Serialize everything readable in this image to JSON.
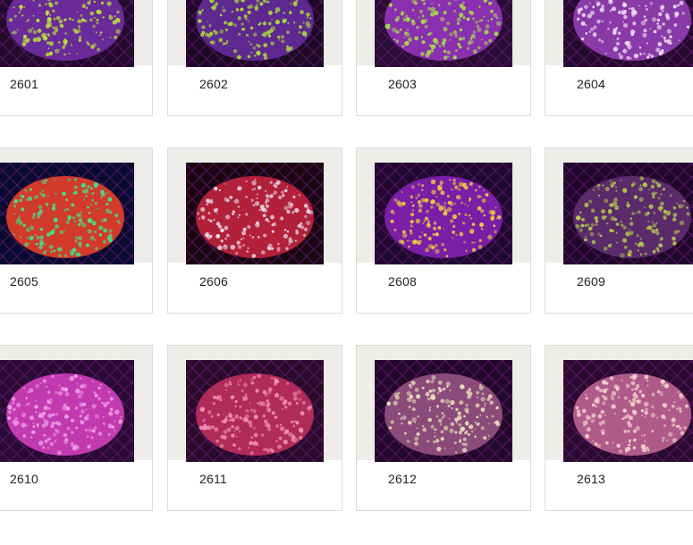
{
  "gallery": {
    "items": [
      {
        "label": "2601",
        "image": "coral-photo-green-rimmed-purple-polyps",
        "palette": [
          "#220a2c",
          "#6a2a9a",
          "#b8e23a"
        ]
      },
      {
        "label": "2602",
        "image": "coral-photo-green-rimmed-purple-polyps",
        "palette": [
          "#1d0826",
          "#5f2891",
          "#a9d93a"
        ]
      },
      {
        "label": "2603",
        "image": "coral-photo-green-rimmed-purple-polyps",
        "palette": [
          "#2a0c34",
          "#8a2fb0",
          "#a6d94a"
        ]
      },
      {
        "label": "2604",
        "image": "coral-photo-purple-mushroom-white-spots",
        "palette": [
          "#240a2c",
          "#8a3aa8",
          "#f0dcf0"
        ]
      },
      {
        "label": "2605",
        "image": "coral-photo-red-mushroom-green-streaks",
        "palette": [
          "#0a0a30",
          "#d23a2a",
          "#44e08a"
        ]
      },
      {
        "label": "2606",
        "image": "coral-photo-red-white-mushroom",
        "palette": [
          "#1a0612",
          "#b2203a",
          "#e8d8e8"
        ]
      },
      {
        "label": "2608",
        "image": "coral-photo-purple-mushroom-gold-rays",
        "palette": [
          "#200830",
          "#7a1ea8",
          "#e8c840"
        ]
      },
      {
        "label": "2609",
        "image": "coral-photo-green-polyp-cluster",
        "palette": [
          "#20082a",
          "#5a2a6a",
          "#b0c850"
        ]
      },
      {
        "label": "2610",
        "image": "coral-photo-pink-polyp-cluster",
        "palette": [
          "#2a0a34",
          "#c23ab0",
          "#f0a0e8"
        ]
      },
      {
        "label": "2611",
        "image": "coral-photo-red-pink-polyp-cluster",
        "palette": [
          "#2a0a2a",
          "#b02a5a",
          "#f090b0"
        ]
      },
      {
        "label": "2612",
        "image": "coral-photo-cream-polyp-cluster",
        "palette": [
          "#22082a",
          "#8a4a7a",
          "#e8e0b8"
        ]
      },
      {
        "label": "2613",
        "image": "coral-photo-cream-pink-polyp-cluster",
        "palette": [
          "#2a0a2e",
          "#b05a8a",
          "#f0d0c8"
        ]
      }
    ]
  }
}
